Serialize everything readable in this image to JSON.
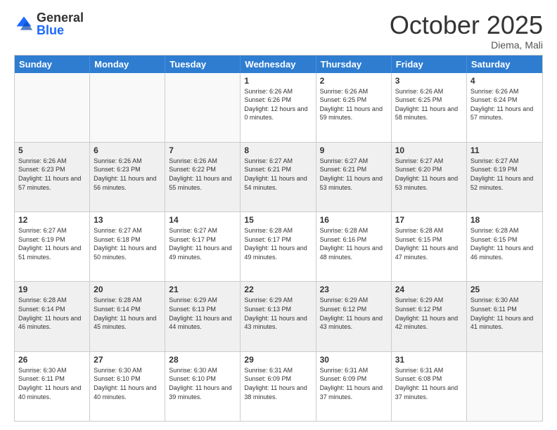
{
  "header": {
    "logo_general": "General",
    "logo_blue": "Blue",
    "month_title": "October 2025",
    "location": "Diema, Mali"
  },
  "calendar": {
    "days_of_week": [
      "Sunday",
      "Monday",
      "Tuesday",
      "Wednesday",
      "Thursday",
      "Friday",
      "Saturday"
    ],
    "rows": [
      [
        {
          "day": "",
          "empty": true
        },
        {
          "day": "",
          "empty": true
        },
        {
          "day": "",
          "empty": true
        },
        {
          "day": "1",
          "sunrise": "6:26 AM",
          "sunset": "6:26 PM",
          "daylight": "12 hours and 0 minutes."
        },
        {
          "day": "2",
          "sunrise": "6:26 AM",
          "sunset": "6:25 PM",
          "daylight": "11 hours and 59 minutes."
        },
        {
          "day": "3",
          "sunrise": "6:26 AM",
          "sunset": "6:25 PM",
          "daylight": "11 hours and 58 minutes."
        },
        {
          "day": "4",
          "sunrise": "6:26 AM",
          "sunset": "6:24 PM",
          "daylight": "11 hours and 57 minutes."
        }
      ],
      [
        {
          "day": "5",
          "sunrise": "6:26 AM",
          "sunset": "6:23 PM",
          "daylight": "11 hours and 57 minutes."
        },
        {
          "day": "6",
          "sunrise": "6:26 AM",
          "sunset": "6:23 PM",
          "daylight": "11 hours and 56 minutes."
        },
        {
          "day": "7",
          "sunrise": "6:26 AM",
          "sunset": "6:22 PM",
          "daylight": "11 hours and 55 minutes."
        },
        {
          "day": "8",
          "sunrise": "6:27 AM",
          "sunset": "6:21 PM",
          "daylight": "11 hours and 54 minutes."
        },
        {
          "day": "9",
          "sunrise": "6:27 AM",
          "sunset": "6:21 PM",
          "daylight": "11 hours and 53 minutes."
        },
        {
          "day": "10",
          "sunrise": "6:27 AM",
          "sunset": "6:20 PM",
          "daylight": "11 hours and 53 minutes."
        },
        {
          "day": "11",
          "sunrise": "6:27 AM",
          "sunset": "6:19 PM",
          "daylight": "11 hours and 52 minutes."
        }
      ],
      [
        {
          "day": "12",
          "sunrise": "6:27 AM",
          "sunset": "6:19 PM",
          "daylight": "11 hours and 51 minutes."
        },
        {
          "day": "13",
          "sunrise": "6:27 AM",
          "sunset": "6:18 PM",
          "daylight": "11 hours and 50 minutes."
        },
        {
          "day": "14",
          "sunrise": "6:27 AM",
          "sunset": "6:17 PM",
          "daylight": "11 hours and 49 minutes."
        },
        {
          "day": "15",
          "sunrise": "6:28 AM",
          "sunset": "6:17 PM",
          "daylight": "11 hours and 49 minutes."
        },
        {
          "day": "16",
          "sunrise": "6:28 AM",
          "sunset": "6:16 PM",
          "daylight": "11 hours and 48 minutes."
        },
        {
          "day": "17",
          "sunrise": "6:28 AM",
          "sunset": "6:15 PM",
          "daylight": "11 hours and 47 minutes."
        },
        {
          "day": "18",
          "sunrise": "6:28 AM",
          "sunset": "6:15 PM",
          "daylight": "11 hours and 46 minutes."
        }
      ],
      [
        {
          "day": "19",
          "sunrise": "6:28 AM",
          "sunset": "6:14 PM",
          "daylight": "11 hours and 46 minutes."
        },
        {
          "day": "20",
          "sunrise": "6:28 AM",
          "sunset": "6:14 PM",
          "daylight": "11 hours and 45 minutes."
        },
        {
          "day": "21",
          "sunrise": "6:29 AM",
          "sunset": "6:13 PM",
          "daylight": "11 hours and 44 minutes."
        },
        {
          "day": "22",
          "sunrise": "6:29 AM",
          "sunset": "6:13 PM",
          "daylight": "11 hours and 43 minutes."
        },
        {
          "day": "23",
          "sunrise": "6:29 AM",
          "sunset": "6:12 PM",
          "daylight": "11 hours and 43 minutes."
        },
        {
          "day": "24",
          "sunrise": "6:29 AM",
          "sunset": "6:12 PM",
          "daylight": "11 hours and 42 minutes."
        },
        {
          "day": "25",
          "sunrise": "6:30 AM",
          "sunset": "6:11 PM",
          "daylight": "11 hours and 41 minutes."
        }
      ],
      [
        {
          "day": "26",
          "sunrise": "6:30 AM",
          "sunset": "6:11 PM",
          "daylight": "11 hours and 40 minutes."
        },
        {
          "day": "27",
          "sunrise": "6:30 AM",
          "sunset": "6:10 PM",
          "daylight": "11 hours and 40 minutes."
        },
        {
          "day": "28",
          "sunrise": "6:30 AM",
          "sunset": "6:10 PM",
          "daylight": "11 hours and 39 minutes."
        },
        {
          "day": "29",
          "sunrise": "6:31 AM",
          "sunset": "6:09 PM",
          "daylight": "11 hours and 38 minutes."
        },
        {
          "day": "30",
          "sunrise": "6:31 AM",
          "sunset": "6:09 PM",
          "daylight": "11 hours and 37 minutes."
        },
        {
          "day": "31",
          "sunrise": "6:31 AM",
          "sunset": "6:08 PM",
          "daylight": "11 hours and 37 minutes."
        },
        {
          "day": "",
          "empty": true
        }
      ]
    ]
  }
}
